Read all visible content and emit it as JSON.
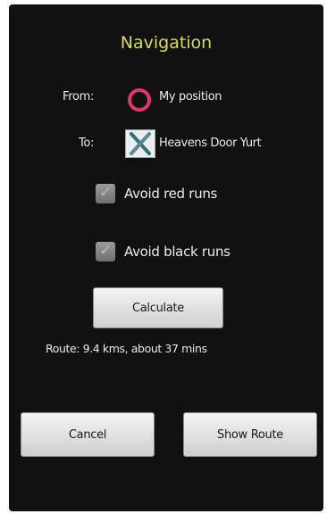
{
  "screen": {
    "title": "Navigation",
    "from_label": "From:",
    "from_value": "My position",
    "from_icon": "location-ring-icon",
    "to_label": "To:",
    "to_value": "Heavens Door Yurt",
    "to_icon": "ski-crossed-icon",
    "avoid_red": {
      "label": "Avoid red runs",
      "checked": true
    },
    "avoid_black": {
      "label": "Avoid black runs",
      "checked": true
    },
    "calculate_label": "Calculate",
    "route_text": "Route: 9.4 kms, about 37 mins",
    "cancel_label": "Cancel",
    "show_route_label": "Show Route"
  },
  "colors": {
    "background": "#111111",
    "title": "#d9d860",
    "position_ring": "#e3356a"
  }
}
